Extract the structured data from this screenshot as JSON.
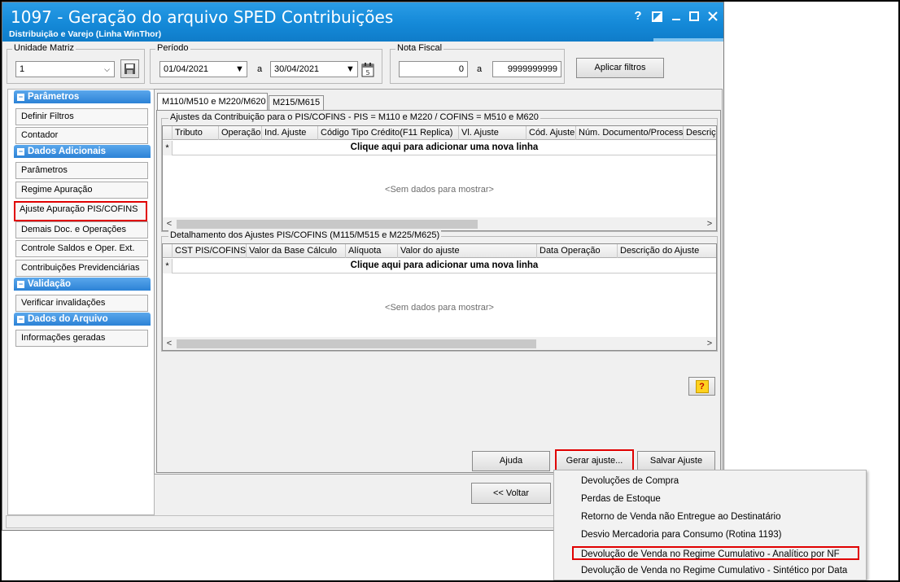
{
  "window": {
    "title": "1097 - Geração do arquivo SPED Contribuições",
    "subtitle": "Distribuição e Varejo (Linha WinThor)",
    "controls": {
      "help": "?",
      "restore": "◪",
      "minimize": "—",
      "maximize": "☐",
      "close": "✕"
    }
  },
  "filters": {
    "unidade_label": "Unidade Matriz",
    "unidade_value": "1",
    "periodo_label": "Período",
    "periodo_start": "01/04/2021",
    "periodo_sep": "a",
    "periodo_end": "30/04/2021",
    "nota_label": "Nota Fiscal",
    "nota_start": "0",
    "nota_sep": "a",
    "nota_end": "9999999999",
    "apply_label": "Aplicar filtros"
  },
  "sidebar": {
    "groups": [
      {
        "title": "Parâmetros",
        "items": [
          "Definir Filtros",
          "Contador"
        ]
      },
      {
        "title": "Dados Adicionais",
        "items": [
          "Parâmetros",
          "Regime Apuração",
          "Ajuste Apuração PIS/COFINS",
          "Demais Doc. e Operações",
          "Controle Saldos e Oper. Ext.",
          "Contribuições Previdenciárias"
        ]
      },
      {
        "title": "Validação",
        "items": [
          "Verificar invalidações"
        ]
      },
      {
        "title": "Dados do Arquivo",
        "items": [
          "Informações geradas"
        ]
      }
    ],
    "selected": "Ajuste Apuração PIS/COFINS"
  },
  "tabs": [
    "M110/M510 e M220/M620",
    "M215/M615"
  ],
  "grid1": {
    "title": "Ajustes da Contribuição para o PIS/COFINS - PIS = M110 e M220 / COFINS = M510 e M620",
    "columns": [
      "Tributo",
      "Operação",
      "Ind. Ajuste",
      "Código Tipo Crédito(F11 Replica)",
      "Vl. Ajuste",
      "Cód. Ajuste",
      "Núm. Documento/Processo",
      "Descriçã"
    ],
    "new_row": "Clique aqui para adicionar uma nova linha",
    "empty": "<Sem dados para mostrar>"
  },
  "grid2": {
    "title": "Detalhamento dos Ajustes PIS/COFINS (M115/M515 e M225/M625)",
    "columns": [
      "CST PIS/COFINS",
      "Valor da Base Cálculo",
      "Alíquota",
      "Valor do ajuste",
      "Data Operação",
      "Descrição do Ajuste"
    ],
    "new_row": "Clique aqui para adicionar uma nova linha",
    "empty": "<Sem dados para mostrar>"
  },
  "buttons": {
    "ajuda": "Ajuda",
    "gerar_ajuste": "Gerar ajuste...",
    "salvar_ajuste": "Salvar Ajuste",
    "voltar": "<< Voltar",
    "help_icon": "?"
  },
  "menu": {
    "items": [
      "Devoluções de Compra",
      "Perdas de Estoque",
      "Retorno de Venda não Entregue ao Destinatário",
      "Desvio Mercadoria para Consumo (Rotina 1193)",
      "Devolução de Venda no Regime Cumulativo - Analítico por NF",
      "Devolução de Venda no Regime Cumulativo - Sintético por Data"
    ]
  },
  "colors": {
    "titlebar": "#1489d8",
    "nav_header": "#2c82d6",
    "highlight": "#e00000"
  }
}
